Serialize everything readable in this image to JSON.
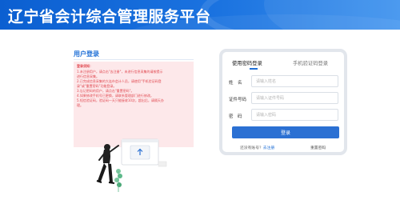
{
  "header": {
    "title": "辽宁省会计综合管理服务平台"
  },
  "left": {
    "heading": "用户登录",
    "notice": {
      "title": "登录须知：",
      "lines": [
        "1.未注册用户，请点击\"去注册\"，未进行信息采集的请按提示",
        "进行信息采集。",
        "2.已完成信息采集的大连市会计人员，请使用\"手机验证码登",
        "录\"或\"重置密码\"功能登录。",
        "3.忘记密码的用户，请点击\"重置密码\"。",
        "4.如果修改手机号已更换，请联系管理部门进行修改。",
        "5.短信验证码，验证码一天只能接收10次，超出后，请隔天办",
        "理。"
      ]
    }
  },
  "login": {
    "tabs": [
      {
        "label": "使用密码登录"
      },
      {
        "label": "手机验证码登录"
      }
    ],
    "name_label": "姓　名",
    "name_placeholder": "请输入姓名",
    "id_label": "证件号码",
    "id_placeholder": "请输入证件号码",
    "password_label": "密　码",
    "password_placeholder": "请输入密码",
    "submit_label": "登录",
    "no_account_text": "还没有账号？",
    "register_label": "去注册",
    "reset_label": "重置密码"
  },
  "colors": {
    "brand_blue": "#1f6fd6",
    "button_blue": "#2b70d3",
    "notice_bg": "#fde8ea",
    "notice_text": "#e0474f"
  }
}
